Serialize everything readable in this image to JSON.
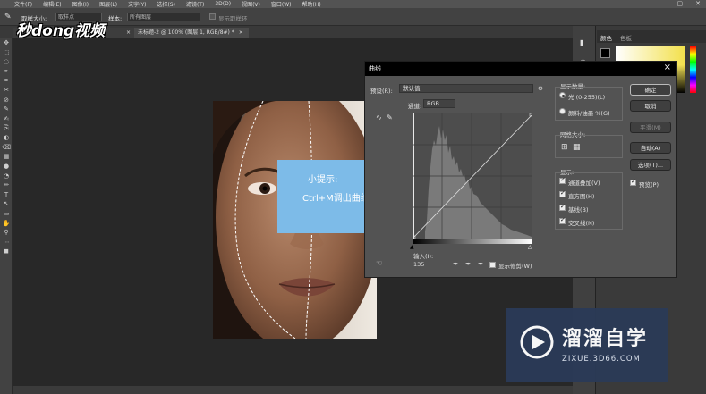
{
  "menu": {
    "items": [
      "文件(F)",
      "编辑(E)",
      "图像(I)",
      "图层(L)",
      "文字(Y)",
      "选择(S)",
      "滤镜(T)",
      "3D(D)",
      "视图(V)",
      "窗口(W)",
      "帮助(H)"
    ],
    "min": "—",
    "max": "▢",
    "close": "✕"
  },
  "options": {
    "sample_size_label": "取样大小:",
    "sample_size_value": "取样点",
    "sample_label": "样本:",
    "sample_value": "所有图层",
    "show_ring_label": "显示取样环"
  },
  "tabs": {
    "doc1": "× ",
    "doc2": "未标题-2 @ 100% (图层 1, RGB/8#) *",
    "doc2_close": "×"
  },
  "tools": [
    "✥",
    "⬚",
    "◌",
    "✒",
    "⌗",
    "✂",
    "⊘",
    "✎",
    "✍",
    "⎘",
    "◐",
    "⌫",
    "▦",
    "●",
    "◔",
    "✏",
    "T",
    "↖",
    "▭",
    "✋",
    "⚲",
    "⋯",
    "◼"
  ],
  "logo": {
    "text": "秒dong视频"
  },
  "tip": {
    "title": "小提示:",
    "text": "Ctrl+M调出曲线面板"
  },
  "curves": {
    "title": "曲线",
    "close": "×",
    "preset_label": "预设(R):",
    "preset_value": "默认值",
    "channel_label": "通道:",
    "channel_value": "RGB",
    "input_label": "输入(I):",
    "input_value": "135",
    "show_clipping": "显示修剪(W)",
    "display_amount_label": "显示数量:",
    "light_option": "光 (0-255)(L)",
    "pigment_option": "颜料/油墨 %(G)",
    "grid_size_label": "网格大小:",
    "show_label": "显示:",
    "show_items": [
      "通道叠加(V)",
      "直方图(H)",
      "基线(B)",
      "交叉线(N)"
    ],
    "ok": "确定",
    "cancel": "取消",
    "smooth": "平滑(M)",
    "auto": "自动(A)",
    "options": "选项(T)...",
    "preview": "预览(P)"
  },
  "panels": {
    "color_tab": "颜色",
    "swatches_tab": "色板"
  },
  "watermark": {
    "brand": "溜溜自学",
    "url": "ZIXUE.3D66.COM"
  },
  "colors": {
    "tip_bg": "#7dbbe8",
    "watermark_bg": "#2b3a57",
    "dialog_bg": "#535353"
  }
}
